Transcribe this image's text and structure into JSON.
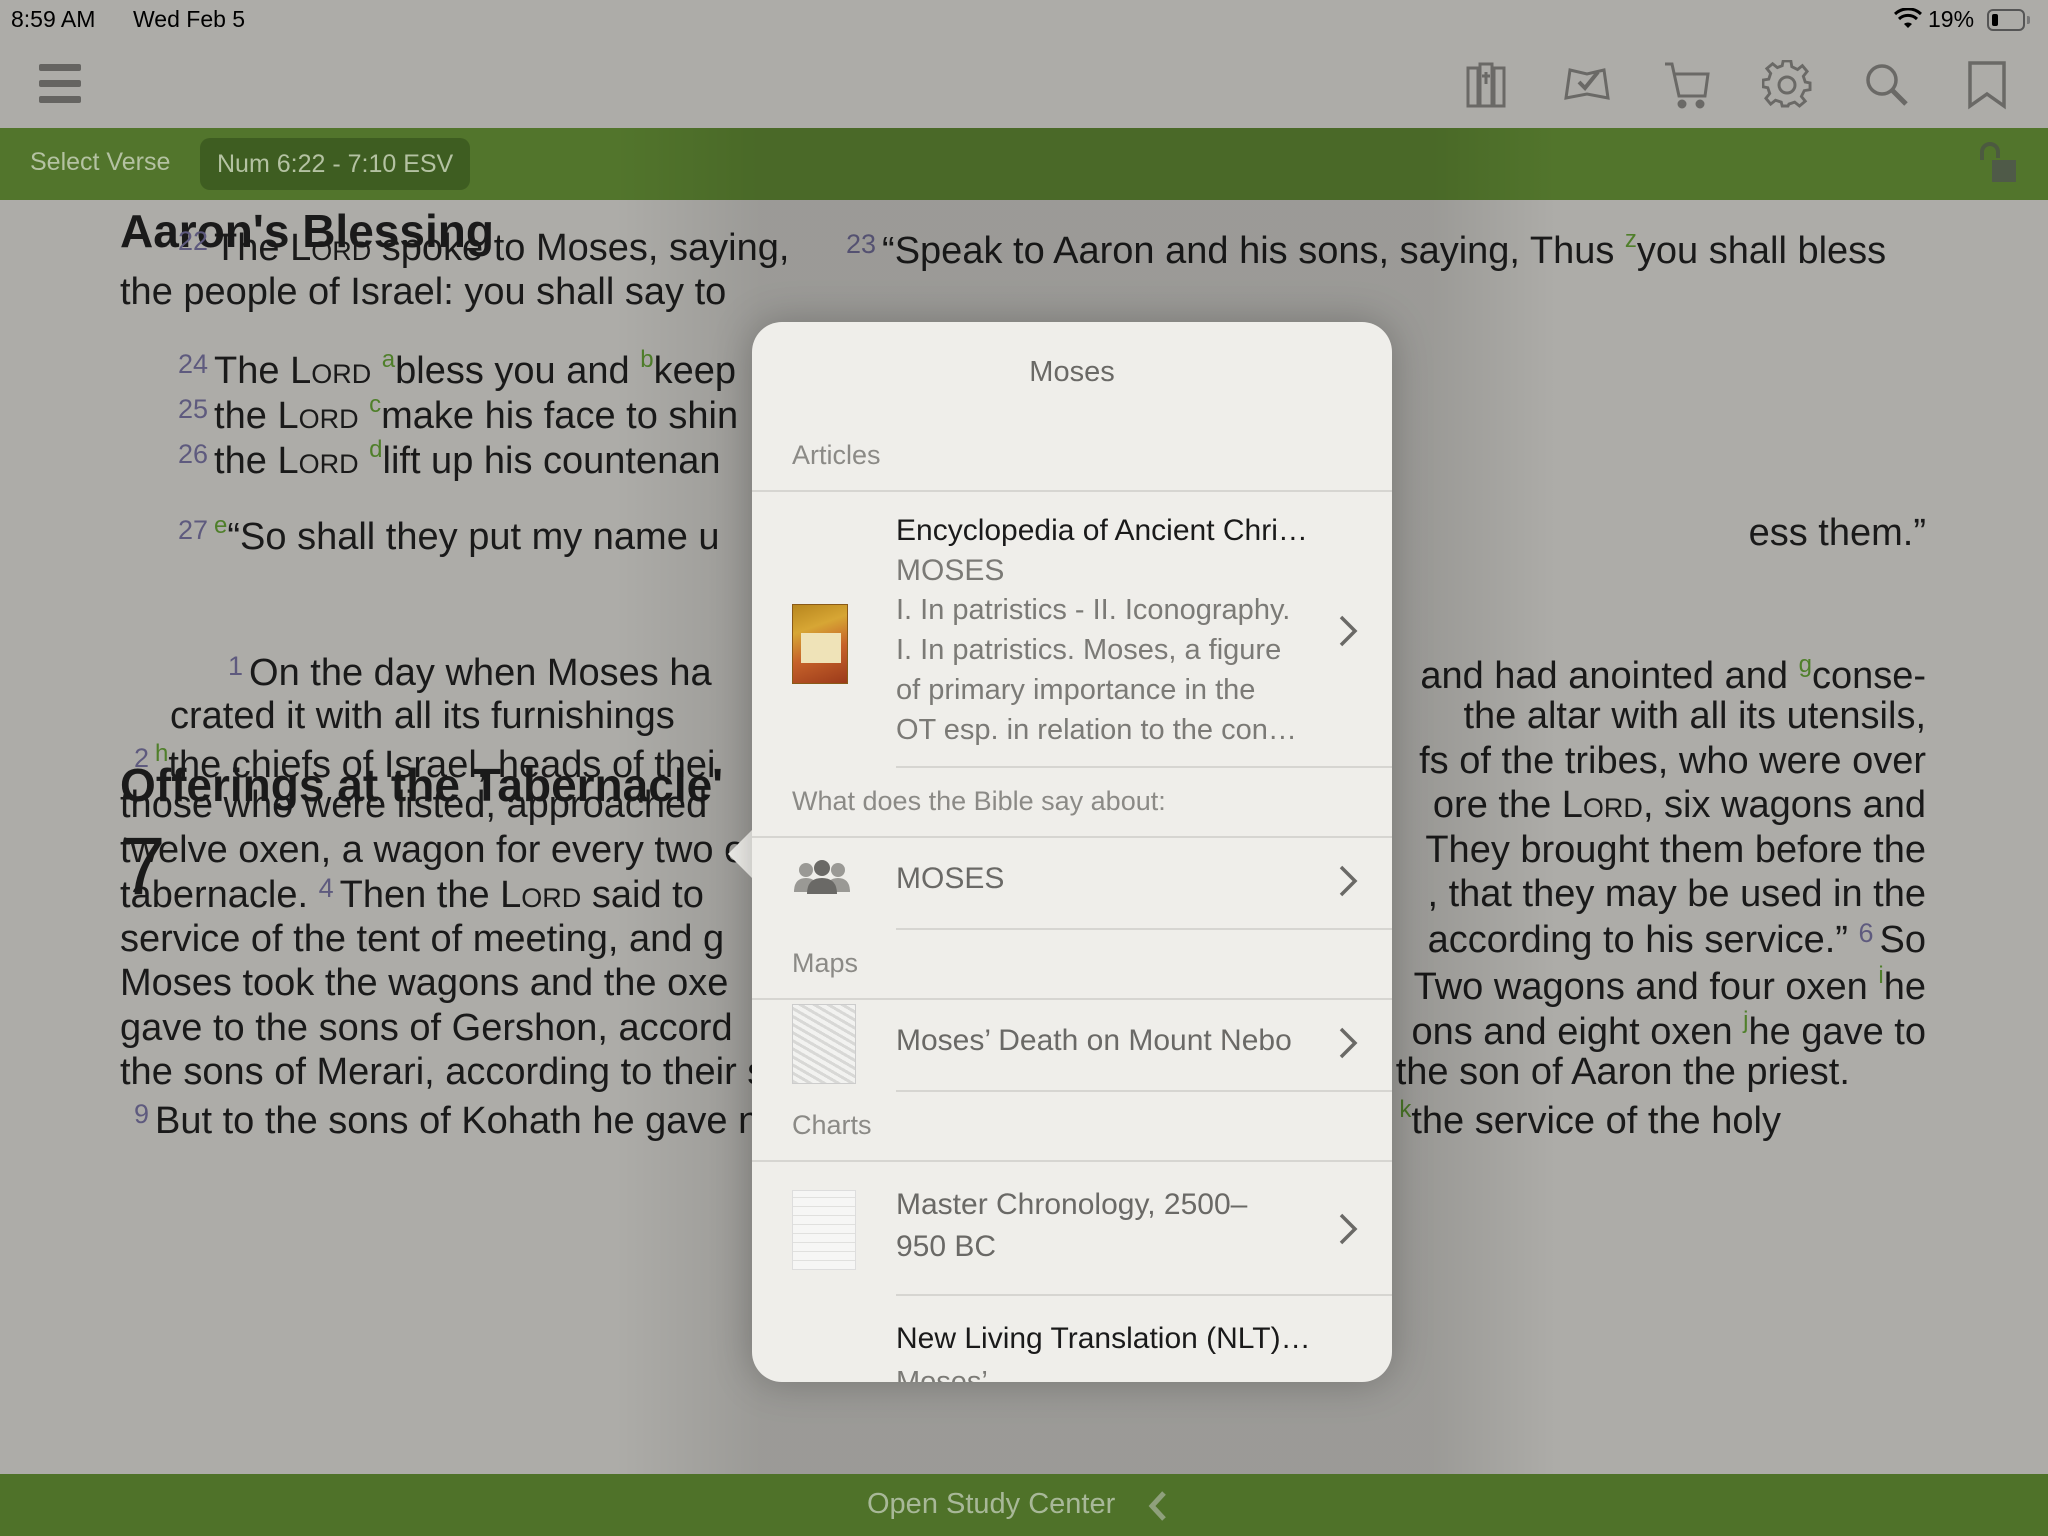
{
  "status_bar": {
    "time": "8:59 AM",
    "date": "Wed Feb 5",
    "battery_percent": "19%",
    "battery_level": 0.19,
    "wifi_icon": "wifi-icon"
  },
  "toolbar": {
    "menu_icon": "hamburger-menu-icon",
    "icons": [
      "library-icon",
      "reading-plan-icon",
      "cart-icon",
      "settings-gear-icon",
      "search-icon",
      "bookmark-icon"
    ]
  },
  "verse_bar": {
    "select_verse_label": "Select Verse",
    "reference": "Num 6:22 - 7:10 ESV",
    "lock_icon": "unlocked-padlock-icon"
  },
  "bible": {
    "heading1": "Aaron's Blessing",
    "heading2_visible": "Offerings at the Tabernacle'",
    "chapter_number": "7",
    "lines": [
      {
        "left": [
          {
            "v": "22"
          },
          {
            "t": "The "
          },
          {
            "sc": "Lord"
          },
          {
            "t": " spoke to Moses, saying,"
          }
        ],
        "right": [
          {
            "v": "23"
          },
          {
            "t": "“Speak to Aaron and his sons, saying, Thus "
          },
          {
            "fn": "z"
          },
          {
            "t": "you shall bless"
          }
        ]
      },
      {
        "left": [
          {
            "t": "the people of Israel: you shall say to"
          }
        ],
        "right": []
      },
      {
        "left": [
          {
            "v": "24"
          },
          {
            "t": "The "
          },
          {
            "sc": "Lord"
          },
          {
            "t": " "
          },
          {
            "fn": "a"
          },
          {
            "t": "bless you and "
          },
          {
            "fn": "b"
          },
          {
            "t": "keep"
          }
        ],
        "right": []
      },
      {
        "left": [
          {
            "v": "25"
          },
          {
            "t": "the "
          },
          {
            "sc": "Lord"
          },
          {
            "t": " "
          },
          {
            "fn": "c"
          },
          {
            "t": "make his face to shin"
          }
        ],
        "right": []
      },
      {
        "left": [
          {
            "v": "26"
          },
          {
            "t": "the "
          },
          {
            "sc": "Lord"
          },
          {
            "t": " "
          },
          {
            "fn": "d"
          },
          {
            "t": "lift up his countenan"
          }
        ],
        "right": []
      },
      {
        "left": [
          {
            "v": "27"
          },
          {
            "fn": "e"
          },
          {
            "t": "“So shall they put my name u"
          }
        ],
        "right": [
          {
            "t": "ess them.”"
          }
        ]
      },
      {
        "left": [
          {
            "v": "1"
          },
          {
            "t": "On the day when Moses ha"
          }
        ],
        "right": [
          {
            "t": "and had anointed and "
          },
          {
            "fn": "g"
          },
          {
            "t": "conse-"
          }
        ]
      },
      {
        "left": [
          {
            "t": "crated it with all its furnishings"
          }
        ],
        "right": [
          {
            "t": "the altar with all its utensils,"
          }
        ]
      },
      {
        "left": [
          {
            "v": "2"
          },
          {
            "fn": "h"
          },
          {
            "t": "the chiefs of Israel, heads of thei"
          }
        ],
        "right": [
          {
            "t": "fs of the tribes, who were over"
          }
        ]
      },
      {
        "left": [
          {
            "t": "those who were listed, approached"
          }
        ],
        "right": [
          {
            "t": "ore the "
          },
          {
            "sc": "Lord"
          },
          {
            "t": ", six wagons and"
          }
        ]
      },
      {
        "left": [
          {
            "t": "twelve oxen, a wagon for every two o"
          }
        ],
        "right": [
          {
            "t": "They brought them before the"
          }
        ]
      },
      {
        "left": [
          {
            "t": "tabernacle. "
          },
          {
            "v": "4"
          },
          {
            "t": "Then the "
          },
          {
            "sc": "Lord"
          },
          {
            "t": " said to"
          }
        ],
        "right": [
          {
            "t": ", that they may be used in the"
          }
        ]
      },
      {
        "left": [
          {
            "t": "service of the tent of meeting, and g"
          }
        ],
        "right": [
          {
            "t": "according to his service.” "
          },
          {
            "v": "6"
          },
          {
            "t": "So"
          }
        ]
      },
      {
        "left": [
          {
            "t": "Moses took the wagons and the oxe"
          }
        ],
        "right": [
          {
            "t": "Two wagons and four oxen "
          },
          {
            "fn": "i"
          },
          {
            "t": "he"
          }
        ]
      },
      {
        "left": [
          {
            "t": "gave to the sons of Gershon, accord"
          }
        ],
        "right": [
          {
            "t": "ons and eight oxen "
          },
          {
            "fn": "j"
          },
          {
            "t": "he gave to"
          }
        ]
      },
      {
        "left": [
          {
            "t": "the sons of Merari, according to their service, under the direction of Ithamar the son of Aaron the priest."
          }
        ],
        "right": []
      },
      {
        "left": [
          {
            "v": "9"
          },
          {
            "t": "But to the sons of Kohath he gave none, because they were charged with "
          },
          {
            "fn": "k"
          },
          {
            "t": "the service of the holy"
          }
        ],
        "right": []
      }
    ]
  },
  "popover": {
    "title": "Moses",
    "sections": {
      "articles": "Articles",
      "bible_says": "What does the Bible say about:",
      "maps": "Maps",
      "charts": "Charts"
    },
    "article": {
      "title": "Encyclopedia of Ancient Chri…",
      "subtitle": "MOSES",
      "lines": [
        "I. In patristics - II. Iconography.",
        "I. In patristics. Moses, a figure",
        "of primary importance in the",
        "OT esp. in relation to the con…"
      ],
      "thumbnail": "book-cover-encyclopedia-of-ancient-christianity"
    },
    "topic": {
      "label": "MOSES",
      "icon": "people-group-icon"
    },
    "map": {
      "label": "Moses’ Death on Mount Nebo",
      "thumbnail": "map-thumbnail"
    },
    "chart": {
      "line1": "Master Chronology, 2500–",
      "line2": "950 BC",
      "thumbnail": "chart-thumbnail"
    },
    "nlt": {
      "title": "New Living Translation (NLT)…",
      "subtitle": "Moses’"
    }
  },
  "bottom_bar": {
    "label": "Open Study Center",
    "chevron_icon": "chevron-left-icon"
  },
  "colors": {
    "brand_green": "#52752c",
    "pill_green": "#3e5d21",
    "footnote_green": "#4f7f2a",
    "verse_number": "#5e5a7e",
    "popover_bg": "#efeeea"
  }
}
